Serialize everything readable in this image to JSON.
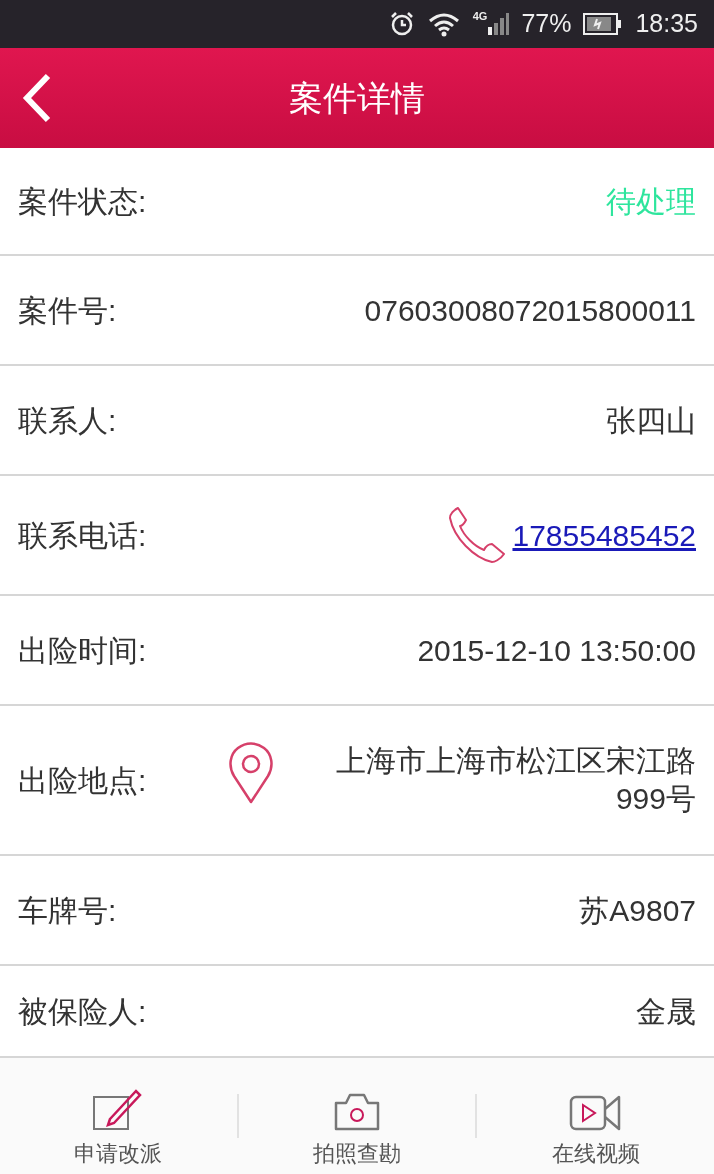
{
  "status_bar": {
    "network": "4G",
    "battery": "77%",
    "time": "18:35"
  },
  "header": {
    "title": "案件详情"
  },
  "fields": [
    {
      "kind": "status",
      "label": "案件状态:",
      "value": "待处理"
    },
    {
      "kind": "text",
      "label": "案件号:",
      "value": "07603008072015800011"
    },
    {
      "kind": "text",
      "label": "联系人:",
      "value": "张四山"
    },
    {
      "kind": "phone",
      "label": "联系电话:",
      "value": "17855485452"
    },
    {
      "kind": "text",
      "label": "出险时间:",
      "value": "2015-12-10 13:50:00"
    },
    {
      "kind": "location",
      "label": "出险地点:",
      "value": "上海市上海市松江区宋江路999号"
    },
    {
      "kind": "text",
      "label": "车牌号:",
      "value": "苏A9807"
    },
    {
      "kind": "text",
      "label": "被保险人:",
      "value": "金晟"
    }
  ],
  "actions": [
    {
      "kind": "edit",
      "label": "申请改派"
    },
    {
      "kind": "camera",
      "label": "拍照查勘"
    },
    {
      "kind": "video",
      "label": "在线视频"
    }
  ]
}
